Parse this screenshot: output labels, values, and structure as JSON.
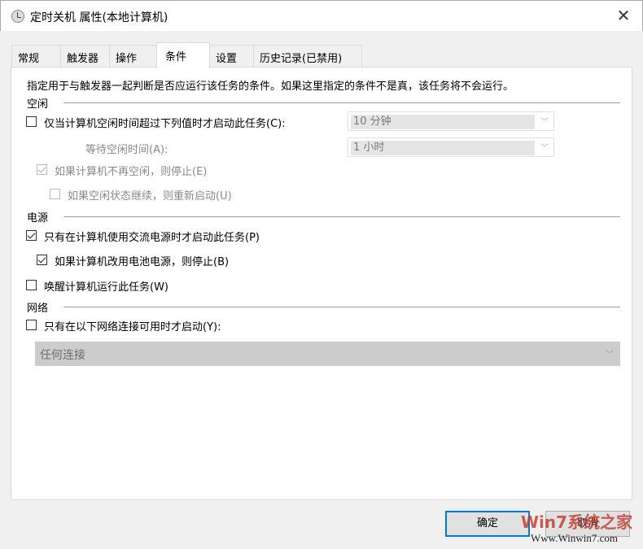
{
  "window": {
    "title": "定时关机 属性(本地计算机)",
    "close": "✕"
  },
  "tabs": [
    "常规",
    "触发器",
    "操作",
    "条件",
    "设置",
    "历史记录(已禁用)"
  ],
  "active_tab": "条件",
  "description": "指定用于与触发器一起判断是否应运行该任务的条件。如果这里指定的条件不是真，该任务将不会运行。",
  "idle": {
    "heading": "空闲",
    "start_if_idle": {
      "label": "仅当计算机空闲时间超过下列值时才启动此任务(C):",
      "checked": false
    },
    "idle_value": "10 分钟",
    "wait_label": "等待空闲时间(A):",
    "wait_value": "1 小时",
    "stop_if_not_idle": {
      "label": "如果计算机不再空闲，则停止(E)",
      "checked": true
    },
    "restart_if_idle": {
      "label": "如果空闲状态继续，则重新启动(U)",
      "checked": false
    }
  },
  "power": {
    "heading": "电源",
    "ac_only": {
      "label": "只有在计算机使用交流电源时才启动此任务(P)",
      "checked": true
    },
    "stop_on_battery": {
      "label": "如果计算机改用电池电源，则停止(B)",
      "checked": true
    },
    "wake": {
      "label": "唤醒计算机运行此任务(W)",
      "checked": false
    }
  },
  "network": {
    "heading": "网络",
    "only_if_network": {
      "label": "只有在以下网络连接可用时才启动(Y):",
      "checked": false
    },
    "connection": "任何连接"
  },
  "buttons": {
    "ok": "确定",
    "cancel": "取消"
  },
  "watermark": {
    "brand": "Win7系统之家",
    "url": "Www.Winwin7.com"
  }
}
